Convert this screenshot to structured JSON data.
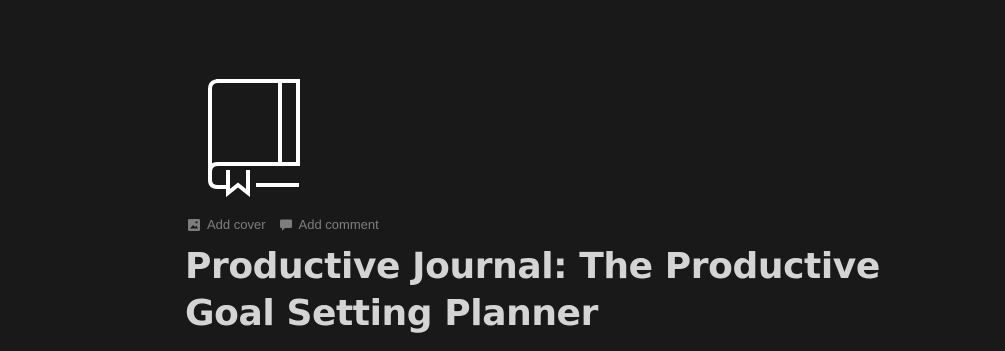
{
  "page": {
    "background_color": "#191919",
    "icon": "book-icon",
    "controls": {
      "add_cover": {
        "label": "Add cover",
        "icon": "image-icon"
      },
      "add_comment": {
        "label": "Add comment",
        "icon": "comment-icon"
      }
    },
    "title": "Productive Journal: The Productive Goal Setting Planner"
  },
  "colors": {
    "title_text": "#d4d4d4",
    "muted_text": "#7d7d7d",
    "icon_stroke": "#ffffff"
  }
}
